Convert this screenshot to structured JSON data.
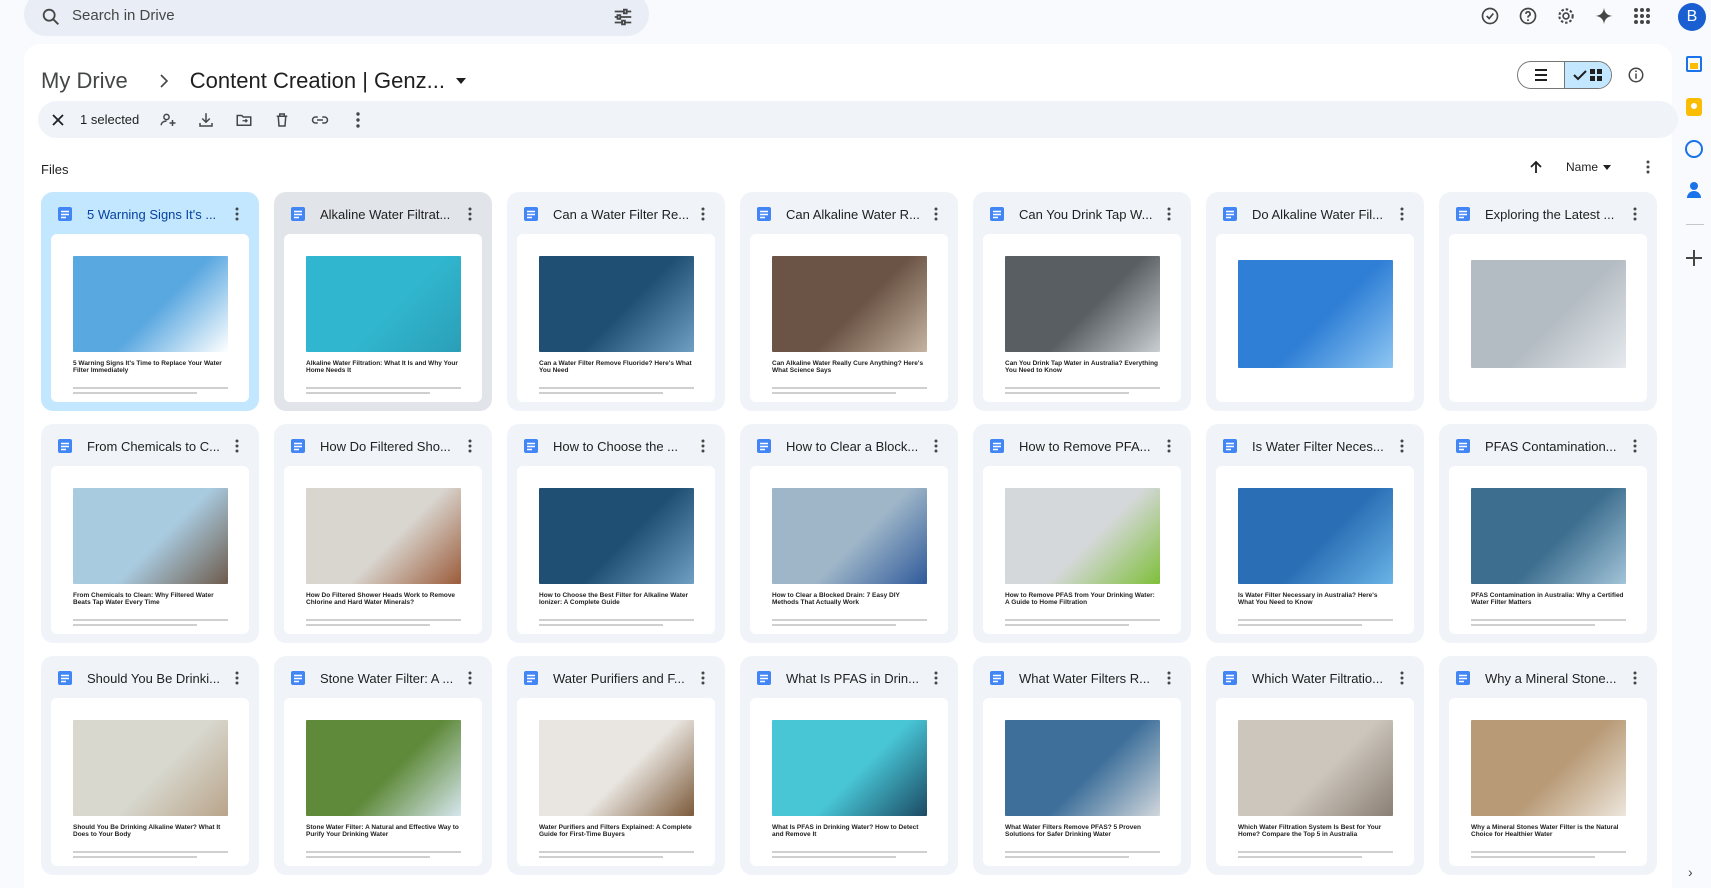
{
  "search": {
    "placeholder": "Search in Drive"
  },
  "top_icons": [
    "offline-ready-icon",
    "help-icon",
    "settings-icon",
    "gemini-icon",
    "apps-icon"
  ],
  "account": {
    "initial": "B",
    "color": "#1a5fd1"
  },
  "breadcrumb": {
    "root": "My Drive",
    "current": "Content Creation | Genz..."
  },
  "selection": {
    "count_label": "1 selected"
  },
  "section": {
    "files_label": "Files"
  },
  "sort": {
    "label": "Name"
  },
  "colors": {
    "selected_card": "#c2e7ff",
    "card": "#f0f4f9",
    "doc_icon": "#4285f4"
  },
  "files": [
    {
      "name": "5 Warning Signs It's ...",
      "caption": "5 Warning Signs It's Time to Replace Your Water Filter Immediately",
      "state": "selected",
      "img": "#5aa8e0",
      "img2": "#ffffff"
    },
    {
      "name": "Alkaline Water Filtrat...",
      "caption": "Alkaline Water Filtration: What It Is and Why Your Home Needs It",
      "state": "hover",
      "img": "#31b6cf",
      "img2": "#2a9fb7"
    },
    {
      "name": "Can a Water Filter Re...",
      "caption": "Can a Water Filter Remove Fluoride? Here's What You Need",
      "state": "",
      "img": "#1f4f73",
      "img2": "#6fa0c4"
    },
    {
      "name": "Can Alkaline Water R...",
      "caption": "Can Alkaline Water Really Cure Anything? Here's What Science Says",
      "state": "",
      "img": "#6b5445",
      "img2": "#c5b3a1"
    },
    {
      "name": "Can You Drink Tap W...",
      "caption": "Can You Drink Tap Water in Australia? Everything You Need to Know",
      "state": "",
      "img": "#595e63",
      "img2": "#c9ced3"
    },
    {
      "name": "Do Alkaline Water Fil...",
      "caption": "",
      "state": "",
      "img": "#2f7fd6",
      "img2": "#8ec6f2"
    },
    {
      "name": "Exploring the Latest ...",
      "caption": "",
      "state": "",
      "img": "#b4bcc3",
      "img2": "#e6eaee"
    },
    {
      "name": "From Chemicals to C...",
      "caption": "From Chemicals to Clean: Why Filtered Water Beats Tap Water Every Time",
      "state": "",
      "img": "#a9cbe0",
      "img2": "#6e5b4c"
    },
    {
      "name": "How Do Filtered Sho...",
      "caption": "How Do Filtered Shower Heads Work to Remove Chlorine and Hard Water Minerals?",
      "state": "",
      "img": "#d9d6d0",
      "img2": "#9b5b3a"
    },
    {
      "name": "How to Choose the ...",
      "caption": "How to Choose the Best Filter for Alkaline Water Ionizer: A Complete Guide",
      "state": "",
      "img": "#1f4f73",
      "img2": "#6fa0c4"
    },
    {
      "name": "How to Clear a Block...",
      "caption": "How to Clear a Blocked Drain: 7 Easy DIY Methods That Actually Work",
      "state": "",
      "img": "#9fb6c8",
      "img2": "#2f5a9a"
    },
    {
      "name": "How to Remove PFA...",
      "caption": "How to Remove PFAS from Your Drinking Water: A Guide to Home Filtration",
      "state": "",
      "img": "#d5d8da",
      "img2": "#7fbf3a"
    },
    {
      "name": "Is Water Filter Neces...",
      "caption": "Is Water Filter Necessary in Australia? Here's What You Need to Know",
      "state": "",
      "img": "#2a6fb5",
      "img2": "#6ab3e6"
    },
    {
      "name": "PFAS Contamination...",
      "caption": "PFAS Contamination in Australia: Why a Certified Water Filter Matters",
      "state": "",
      "img": "#3d6e8f",
      "img2": "#a3c4d8"
    },
    {
      "name": "Should You Be Drinki...",
      "caption": "Should You Be Drinking Alkaline Water? What It Does to Your Body",
      "state": "",
      "img": "#d8d8cf",
      "img2": "#b9a48a"
    },
    {
      "name": "Stone Water Filter: A ...",
      "caption": "Stone Water Filter: A Natural and Effective Way to Purify Your Drinking Water",
      "state": "",
      "img": "#5f8a3a",
      "img2": "#d6e6ee"
    },
    {
      "name": "Water Purifiers and F...",
      "caption": "Water Purifiers and Filters Explained: A Complete Guide for First-Time Buyers",
      "state": "",
      "img": "#e9e6e1",
      "img2": "#7c5a3a"
    },
    {
      "name": "What Is PFAS in Drin...",
      "caption": "What Is PFAS in Drinking Water? How to Detect and Remove It",
      "state": "",
      "img": "#48c6d6",
      "img2": "#1c4a63"
    },
    {
      "name": "What Water Filters R...",
      "caption": "What Water Filters Remove PFAS? 5 Proven Solutions for Safer Drinking Water",
      "state": "",
      "img": "#3d6f9a",
      "img2": "#d1d7dc"
    },
    {
      "name": "Which Water Filtratio...",
      "caption": "Which Water Filtration System Is Best for Your Home? Compare the Top 5 in Australia",
      "state": "",
      "img": "#cdc6bd",
      "img2": "#8a7f74"
    },
    {
      "name": "Why a Mineral Stone...",
      "caption": "Why a Mineral Stones Water Filter is the Natural Choice for Healthier Water",
      "state": "",
      "img": "#b89a76",
      "img2": "#ede6dc"
    }
  ]
}
